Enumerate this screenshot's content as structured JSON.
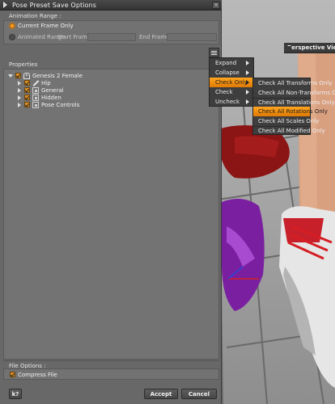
{
  "viewport": {
    "title": "Perspective View"
  },
  "dialog": {
    "title": "Pose Preset Save Options",
    "close_label": "×",
    "animation_range": {
      "section_label": "Animation Range :",
      "current_frame_only": "Current Frame Only",
      "animated_range": "Animated Range",
      "start_frame_label": "Start Frame :",
      "end_frame_label": "End Frame :",
      "selected": "current_frame_only"
    },
    "properties": {
      "section_label": "Properties",
      "tree": [
        {
          "label": "Genesis 2 Female",
          "icon": "figure-icon",
          "expanded": true,
          "checked": true
        },
        {
          "label": "Hip",
          "icon": "bone-icon",
          "expanded": false,
          "checked": true
        },
        {
          "label": "General",
          "icon": "group-icon",
          "expanded": false,
          "checked": true
        },
        {
          "label": "Hidden",
          "icon": "group-icon",
          "expanded": false,
          "checked": true
        },
        {
          "label": "Pose Controls",
          "icon": "group-icon",
          "expanded": false,
          "checked": true
        }
      ]
    },
    "file_options": {
      "section_label": "File Options :",
      "compress_file": "Compress File",
      "compress_checked": true
    },
    "buttons": {
      "help": "k?",
      "accept": "Accept",
      "cancel": "Cancel"
    }
  },
  "context_menu": {
    "items": [
      {
        "label": "Expand",
        "submenu": true,
        "active": false
      },
      {
        "label": "Collapse",
        "submenu": true,
        "active": false
      },
      {
        "label": "Check Only",
        "submenu": true,
        "active": true
      },
      {
        "label": "Check",
        "submenu": true,
        "active": false
      },
      {
        "label": "Uncheck",
        "submenu": true,
        "active": false
      }
    ]
  },
  "submenu": {
    "items": [
      {
        "label": "Check All Transforms Only",
        "active": false
      },
      {
        "label": "Check All Non-Transforms Only",
        "active": false
      },
      {
        "label": "Check All Translations Only",
        "active": false
      },
      {
        "label": "Check All Rotations Only",
        "active": true
      },
      {
        "label": "Check All Scales Only",
        "active": false
      },
      {
        "label": "Check All Modified Only",
        "active": false
      }
    ]
  },
  "colors": {
    "accent": "#ff9d1a",
    "menu_bg": "#3e3e3e",
    "dialog_bg": "#686868"
  }
}
